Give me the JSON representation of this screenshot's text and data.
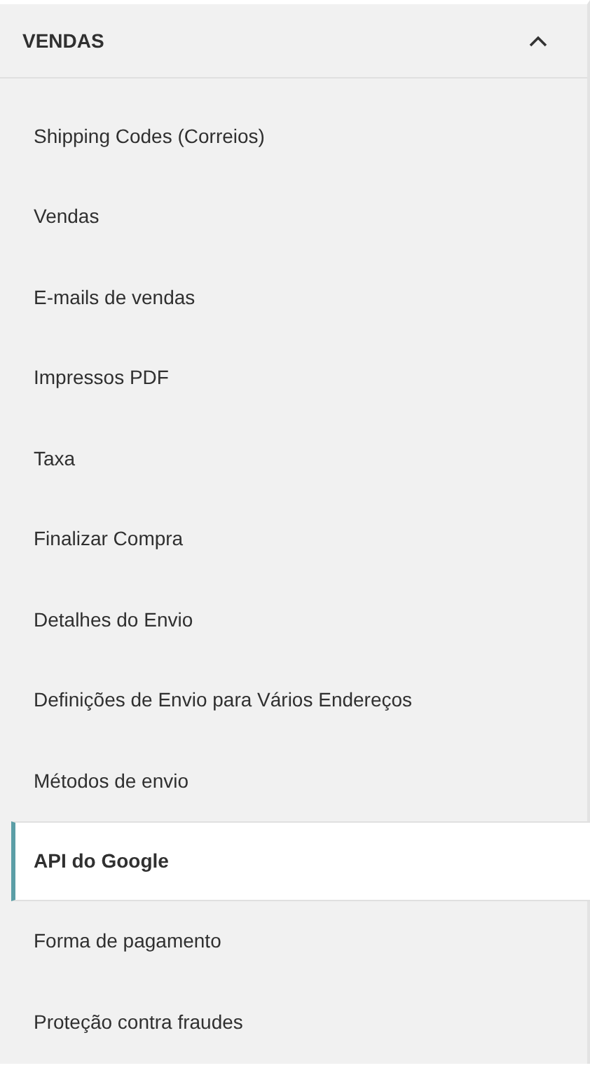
{
  "section": {
    "title": "VENDAS",
    "expanded": true
  },
  "items": [
    {
      "label": "Shipping Codes (Correios)",
      "selected": false
    },
    {
      "label": "Vendas",
      "selected": false
    },
    {
      "label": "E-mails de vendas",
      "selected": false
    },
    {
      "label": "Impressos PDF",
      "selected": false
    },
    {
      "label": "Taxa",
      "selected": false
    },
    {
      "label": "Finalizar Compra",
      "selected": false
    },
    {
      "label": "Detalhes do Envio",
      "selected": false
    },
    {
      "label": "Definições de Envio para Vários Endereços",
      "selected": false
    },
    {
      "label": "Métodos de envio",
      "selected": false
    },
    {
      "label": "API do Google",
      "selected": true
    },
    {
      "label": "Forma de pagamento",
      "selected": false
    },
    {
      "label": "Proteção contra fraudes",
      "selected": false
    }
  ]
}
